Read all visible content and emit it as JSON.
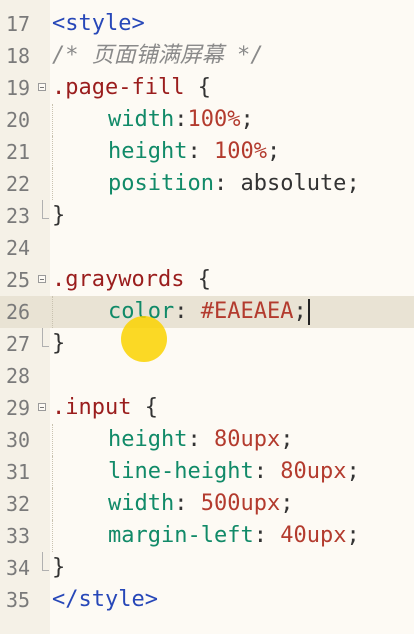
{
  "editor": {
    "lines": [
      {
        "num": "17",
        "fold": "none",
        "indent": 0,
        "tokens": [
          {
            "t": "<style>",
            "k": "tag"
          }
        ]
      },
      {
        "num": "18",
        "fold": "none",
        "indent": 0,
        "tokens": [
          {
            "t": "/* ",
            "k": "comment"
          },
          {
            "t": "页面铺满屏幕",
            "k": "comment"
          },
          {
            "t": " */",
            "k": "comment"
          }
        ]
      },
      {
        "num": "19",
        "fold": "open",
        "indent": 0,
        "tokens": [
          {
            "t": ".page-fill",
            "k": "sel"
          },
          {
            "t": " {",
            "k": "punct"
          }
        ]
      },
      {
        "num": "20",
        "fold": "none",
        "indent": 1,
        "tokens": [
          {
            "t": "width",
            "k": "prop"
          },
          {
            "t": ":",
            "k": "punct"
          },
          {
            "t": "100",
            "k": "num"
          },
          {
            "t": "%",
            "k": "num"
          },
          {
            "t": ";",
            "k": "punct"
          }
        ]
      },
      {
        "num": "21",
        "fold": "none",
        "indent": 1,
        "tokens": [
          {
            "t": "height",
            "k": "prop"
          },
          {
            "t": ": ",
            "k": "punct"
          },
          {
            "t": "100",
            "k": "num"
          },
          {
            "t": "%",
            "k": "num"
          },
          {
            "t": ";",
            "k": "punct"
          }
        ]
      },
      {
        "num": "22",
        "fold": "none",
        "indent": 1,
        "tokens": [
          {
            "t": "position",
            "k": "prop"
          },
          {
            "t": ": ",
            "k": "punct"
          },
          {
            "t": "absolute",
            "k": "val"
          },
          {
            "t": ";",
            "k": "punct"
          }
        ]
      },
      {
        "num": "23",
        "fold": "end",
        "indent": 0,
        "tokens": [
          {
            "t": "}",
            "k": "punct"
          }
        ]
      },
      {
        "num": "24",
        "fold": "none",
        "indent": 0,
        "tokens": []
      },
      {
        "num": "25",
        "fold": "open",
        "indent": 0,
        "tokens": [
          {
            "t": ".graywords",
            "k": "sel"
          },
          {
            "t": " {",
            "k": "punct"
          }
        ]
      },
      {
        "num": "26",
        "fold": "none",
        "indent": 1,
        "current": true,
        "tokens": [
          {
            "t": "color",
            "k": "prop"
          },
          {
            "t": ": ",
            "k": "punct"
          },
          {
            "t": "#EAEAEA",
            "k": "color"
          },
          {
            "t": ";",
            "k": "punct"
          }
        ]
      },
      {
        "num": "27",
        "fold": "end",
        "indent": 0,
        "tokens": [
          {
            "t": "}",
            "k": "punct"
          }
        ]
      },
      {
        "num": "28",
        "fold": "none",
        "indent": 0,
        "tokens": []
      },
      {
        "num": "29",
        "fold": "open",
        "indent": 0,
        "tokens": [
          {
            "t": ".input",
            "k": "sel"
          },
          {
            "t": " {",
            "k": "punct"
          }
        ]
      },
      {
        "num": "30",
        "fold": "none",
        "indent": 1,
        "tokens": [
          {
            "t": "height",
            "k": "prop"
          },
          {
            "t": ": ",
            "k": "punct"
          },
          {
            "t": "80",
            "k": "num"
          },
          {
            "t": "upx",
            "k": "num"
          },
          {
            "t": ";",
            "k": "punct"
          }
        ]
      },
      {
        "num": "31",
        "fold": "none",
        "indent": 1,
        "tokens": [
          {
            "t": "line-height",
            "k": "prop"
          },
          {
            "t": ": ",
            "k": "punct"
          },
          {
            "t": "80",
            "k": "num"
          },
          {
            "t": "upx",
            "k": "num"
          },
          {
            "t": ";",
            "k": "punct"
          }
        ]
      },
      {
        "num": "32",
        "fold": "none",
        "indent": 1,
        "tokens": [
          {
            "t": "width",
            "k": "prop"
          },
          {
            "t": ": ",
            "k": "punct"
          },
          {
            "t": "500",
            "k": "num"
          },
          {
            "t": "upx",
            "k": "num"
          },
          {
            "t": ";",
            "k": "punct"
          }
        ]
      },
      {
        "num": "33",
        "fold": "none",
        "indent": 1,
        "tokens": [
          {
            "t": "margin-left",
            "k": "prop"
          },
          {
            "t": ": ",
            "k": "punct"
          },
          {
            "t": "40",
            "k": "num"
          },
          {
            "t": "upx",
            "k": "num"
          },
          {
            "t": ";",
            "k": "punct"
          }
        ]
      },
      {
        "num": "34",
        "fold": "end",
        "indent": 0,
        "tokens": [
          {
            "t": "}",
            "k": "punct"
          }
        ]
      },
      {
        "num": "35",
        "fold": "none",
        "indent": 0,
        "tokens": [
          {
            "t": "</style>",
            "k": "tag"
          }
        ]
      }
    ]
  },
  "colors": {
    "background": "#fdfaf4",
    "current_line": "#e9e3d4",
    "tag": "#2747b8",
    "selector": "#9a1d1d",
    "property": "#118a68",
    "number": "#b33b2e",
    "comment": "#8a8a8a",
    "click_indicator": "#fad200"
  },
  "icons": {
    "fold_open": "fold-minus-icon",
    "fold_end": "fold-end-marker-icon",
    "click": "click-highlight-icon"
  }
}
